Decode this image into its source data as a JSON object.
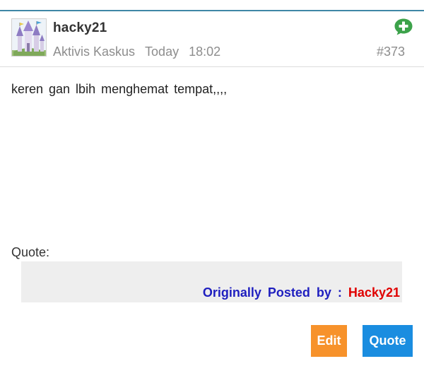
{
  "post": {
    "username": "hacky21",
    "rank": "Aktivis Kaskus",
    "date": "Today",
    "time": "18:02",
    "number": "#373",
    "body": "keren gan lbih menghemat tempat,,,,"
  },
  "quote": {
    "label": "Quote:",
    "originally_posted_by": "Originally Posted by :",
    "author": "Hacky21"
  },
  "actions": {
    "edit_label": "Edit",
    "quote_label": "Quote"
  },
  "icons": {
    "avatar": "castle-avatar-image",
    "add": "add-plus-icon"
  },
  "colors": {
    "top_border": "#3f87a6",
    "edit_button": "#f7922b",
    "quote_button": "#1a8de0",
    "add_icon": "#3ca24a",
    "attribution": "#1f1fbf",
    "author": "#e00000"
  }
}
